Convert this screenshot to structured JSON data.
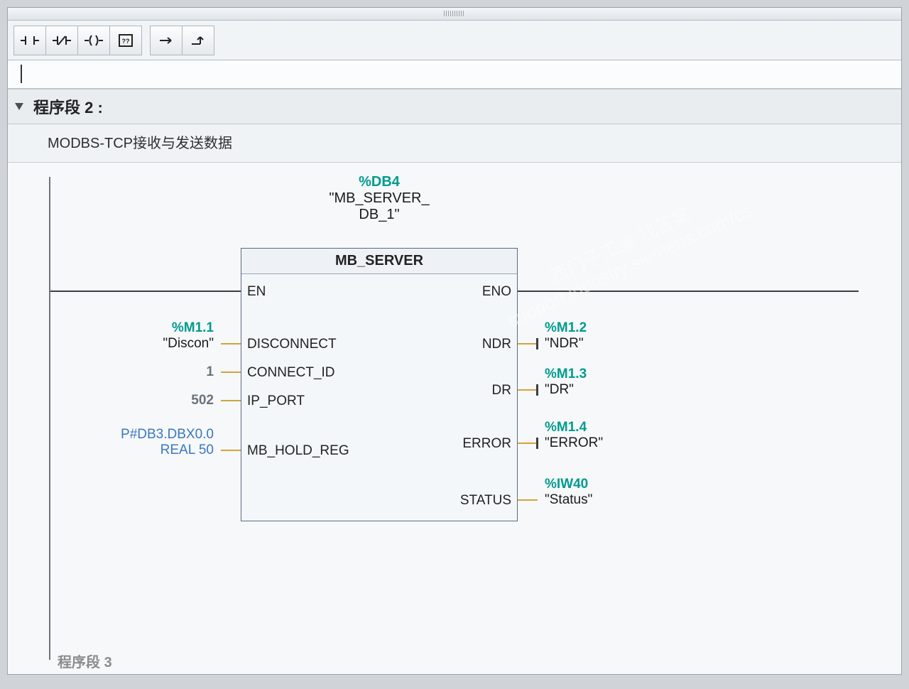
{
  "toolbar": {
    "btn_no_contact": "⊣⊢",
    "btn_nc_contact": "⊣/⊢",
    "btn_coil": "⊸⊃",
    "btn_box": "[??]",
    "btn_branch_open": "↦",
    "btn_branch_close": "↥"
  },
  "network": {
    "title": "程序段 2 :",
    "comment": "MODBS-TCP接收与发送数据"
  },
  "block": {
    "db_addr": "%DB4",
    "db_sym_line1": "\"MB_SERVER_",
    "db_sym_line2": "DB_1\"",
    "name": "MB_SERVER",
    "inputs": {
      "en": "EN",
      "disconnect": "DISCONNECT",
      "connect_id": "CONNECT_ID",
      "ip_port": "IP_PORT",
      "mb_hold_reg": "MB_HOLD_REG"
    },
    "outputs": {
      "eno": "ENO",
      "ndr": "NDR",
      "dr": "DR",
      "error": "ERROR",
      "status": "STATUS"
    }
  },
  "operands": {
    "in": {
      "discon_addr": "%M1.1",
      "discon_sym": "\"Discon\"",
      "connect_id_val": "1",
      "ip_port_val": "502",
      "holdreg_line1": "P#DB3.DBX0.0",
      "holdreg_line2": "REAL 50"
    },
    "out": {
      "ndr_addr": "%M1.2",
      "ndr_sym": "\"NDR\"",
      "dr_addr": "%M1.3",
      "dr_sym": "\"DR\"",
      "err_addr": "%M1.4",
      "err_sym": "\"ERROR\"",
      "status_addr": "%IW40",
      "status_sym": "\"Status\""
    }
  },
  "watermark": {
    "l1": "西门子工业 找答案",
    "l2": "support.industry.siemens.com/cs"
  },
  "footer": "程序段 3"
}
